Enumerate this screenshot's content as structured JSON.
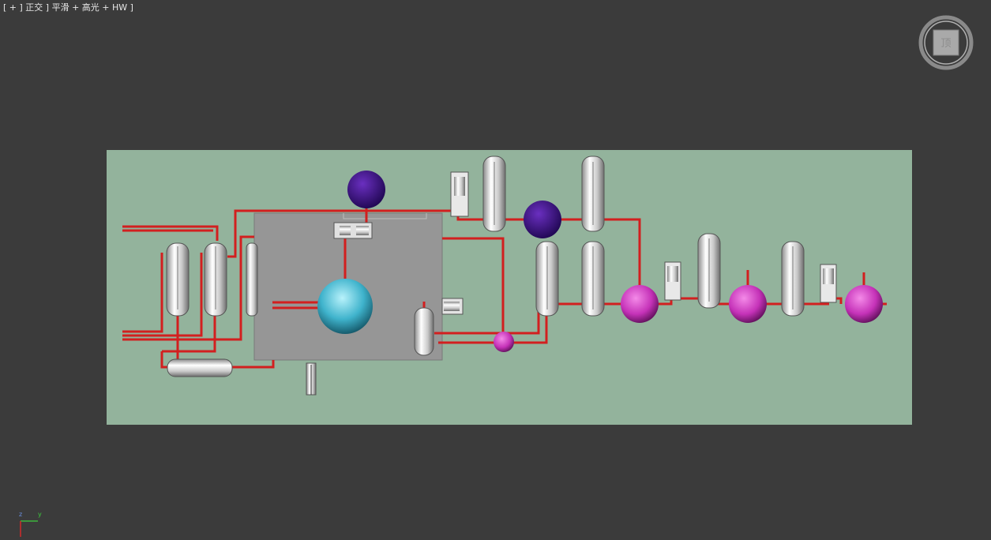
{
  "viewport": {
    "label": "[ + ] 正交 ] 平滑 + 高光 + HW ]"
  },
  "colors": {
    "viewport_bg": "#3b3b3b",
    "ground": "#93b39c",
    "panel": "#969696",
    "pipe": "#d21f1f",
    "vessel_metal": "#dcdcdc",
    "sphere_purple": "#4a1a8c",
    "sphere_magenta": "#d43fc6",
    "sphere_cyan": "#5ec9de"
  },
  "viewcube": {
    "face_label": "顶",
    "icon": "viewcube-icon"
  },
  "axis_gizmo": {
    "x_label": "x",
    "y_label": "y",
    "z_label": "z"
  }
}
